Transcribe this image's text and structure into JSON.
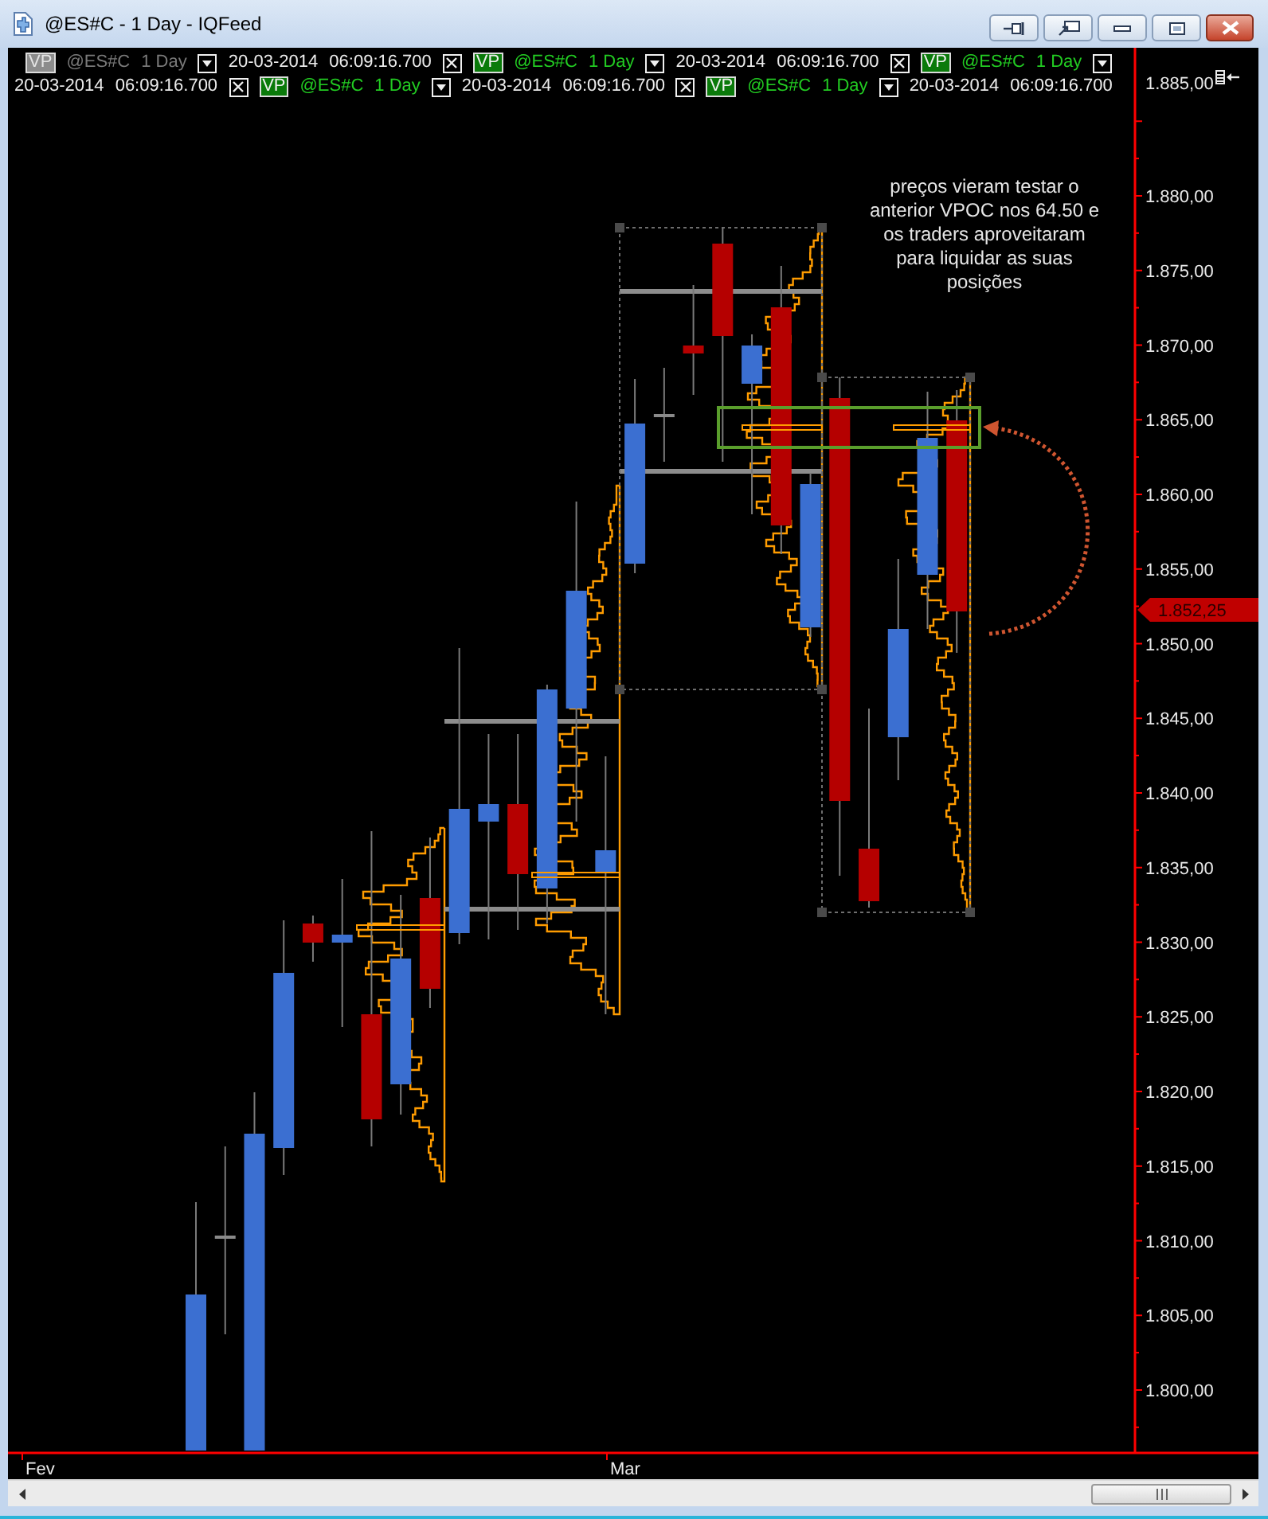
{
  "window": {
    "title": "@ES#C - 1 Day - IQFeed"
  },
  "legend": [
    {
      "badge": "VP",
      "symbol": "@ES#C",
      "interval": "1 Day",
      "timestamp": "20-03-2014 06:09:16.700",
      "enabled": false,
      "closable": true
    },
    {
      "badge": "VP",
      "symbol": "@ES#C",
      "interval": "1 Day",
      "timestamp": "20-03-2014 06:09:16.700",
      "enabled": true,
      "closable": true
    },
    {
      "badge": "VP",
      "symbol": "@ES#C",
      "interval": "1 Day",
      "timestamp": "20-03-2014 06:09:16.700",
      "enabled": true,
      "closable": true
    },
    {
      "badge": "VP",
      "symbol": "@ES#C",
      "interval": "1 Day",
      "timestamp": "20-03-2014 06:09:16.700",
      "enabled": true,
      "closable": true
    },
    {
      "badge": "VP",
      "symbol": "@ES#C",
      "interval": "1 Day",
      "timestamp": "20-03-2014 06:09:16.700",
      "enabled": true,
      "closable": false
    }
  ],
  "annotation": {
    "text": "preços vieram testar o\nanterior VPOC nos 64.50 e\nos traders aproveitaram\npara liquidar as suas\nposições"
  },
  "price_axis": {
    "labels": [
      "1.885,00",
      "1.880,00",
      "1.875,00",
      "1.870,00",
      "1.865,00",
      "1.860,00",
      "1.855,00",
      "1.850,00",
      "1.845,00",
      "1.840,00",
      "1.835,00",
      "1.830,00",
      "1.825,00",
      "1.820,00",
      "1.815,00",
      "1.810,00",
      "1.805,00",
      "1.800,00"
    ],
    "current_price": "1.852,25"
  },
  "time_axis": {
    "labels": [
      "Fev",
      "Mar"
    ]
  }
}
